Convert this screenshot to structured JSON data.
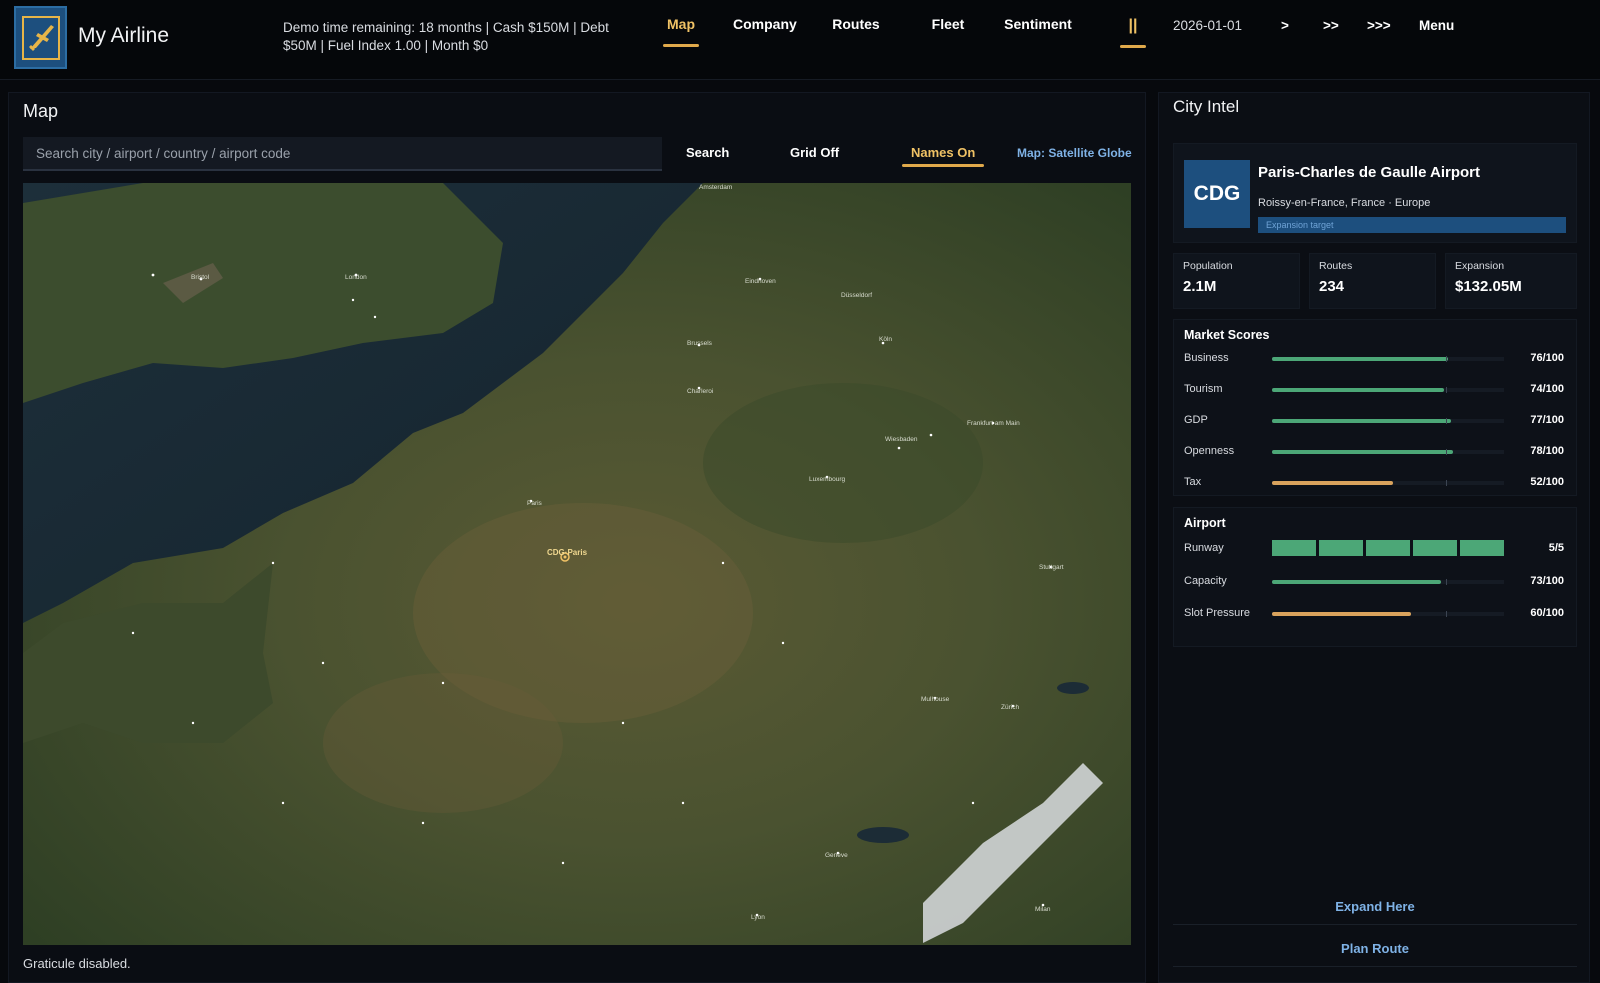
{
  "app": {
    "title": "My Airline",
    "status_line": "Demo time remaining: 18 months  |  Cash $150M  |  Debt $50M  |  Fuel Index 1.00  |  Month $0",
    "nav": [
      "Map",
      "Company",
      "Routes",
      "Fleet",
      "Sentiment"
    ],
    "active_nav": "Map",
    "pause_label": "||",
    "date": "2026-01-01",
    "speeds": [
      ">",
      ">>",
      ">>>"
    ],
    "menu_label": "Menu"
  },
  "map_panel": {
    "title": "Map",
    "search_placeholder": "Search city / airport / country / airport code",
    "search_button": "Search",
    "grid_toggle": "Grid Off",
    "names_toggle": "Names On",
    "map_mode": "Map: Satellite Globe",
    "map_labels": [
      "Amsterdam",
      "Bristol",
      "London",
      "Eindhoven",
      "Düsseldorf",
      "Brussels",
      "Köln",
      "Charleroi",
      "Frankfurt am Main",
      "Wiesbaden",
      "Luxembourg",
      "Paris",
      "CDG·Paris",
      "Stuttgart",
      "Mulhouse",
      "Zürich",
      "Genève",
      "Lyon",
      "Milan"
    ],
    "footer_note": "Graticule disabled."
  },
  "intel": {
    "title": "City Intel",
    "airport_code": "CDG",
    "airport_name": "Paris-Charles de Gaulle Airport",
    "location": "Roissy-en-France, France · Europe",
    "tag": "Expansion target",
    "stats": [
      {
        "label": "Population",
        "value": "2.1M"
      },
      {
        "label": "Routes",
        "value": "234"
      },
      {
        "label": "Expansion",
        "value": "$132.05M"
      }
    ],
    "market_title": "Market Scores",
    "market_scores": [
      {
        "label": "Business",
        "value": "76/100",
        "score": 76,
        "color": "#4ca777"
      },
      {
        "label": "Tourism",
        "value": "74/100",
        "score": 74,
        "color": "#4ca777"
      },
      {
        "label": "GDP",
        "value": "77/100",
        "score": 77,
        "color": "#4ca777"
      },
      {
        "label": "Openness",
        "value": "78/100",
        "score": 78,
        "color": "#4ca777"
      },
      {
        "label": "Tax",
        "value": "52/100",
        "score": 52,
        "color": "#d9a35d"
      }
    ],
    "airport_title": "Airport",
    "runway": {
      "label": "Runway",
      "value": "5/5",
      "filled": 5,
      "total": 5
    },
    "airport_metrics": [
      {
        "label": "Capacity",
        "value": "73/100",
        "score": 73,
        "color": "#4ca777"
      },
      {
        "label": "Slot Pressure",
        "value": "60/100",
        "score": 60,
        "color": "#d9a35d"
      }
    ],
    "actions": [
      "Expand Here",
      "Plan Route"
    ]
  }
}
